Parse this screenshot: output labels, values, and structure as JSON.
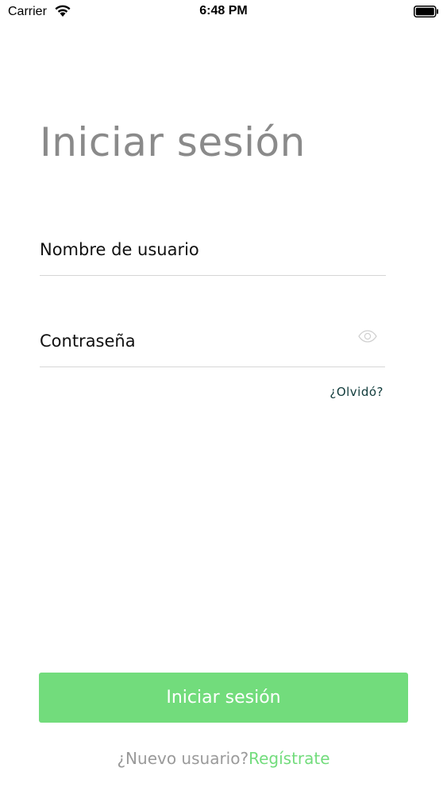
{
  "status_bar": {
    "carrier": "Carrier",
    "time": "6:48 PM",
    "wifi_icon": "wifi-icon",
    "battery_icon": "battery-full-icon"
  },
  "login": {
    "title": "Iniciar sesión",
    "username_placeholder": "Nombre de usuario",
    "username_value": "",
    "password_placeholder": "Contraseña",
    "password_value": "",
    "password_toggle_icon": "eye-icon",
    "forgot_label": "¿Olvidó?",
    "submit_label": "Iniciar sesión",
    "new_user_prompt": "¿Nuevo usuario?",
    "register_label": "Regístrate"
  },
  "colors": {
    "accent": "#72dc7c",
    "title_gray": "#8a8a8a",
    "forgot_link": "#0f3a3a",
    "divider": "#d6d6d6"
  }
}
